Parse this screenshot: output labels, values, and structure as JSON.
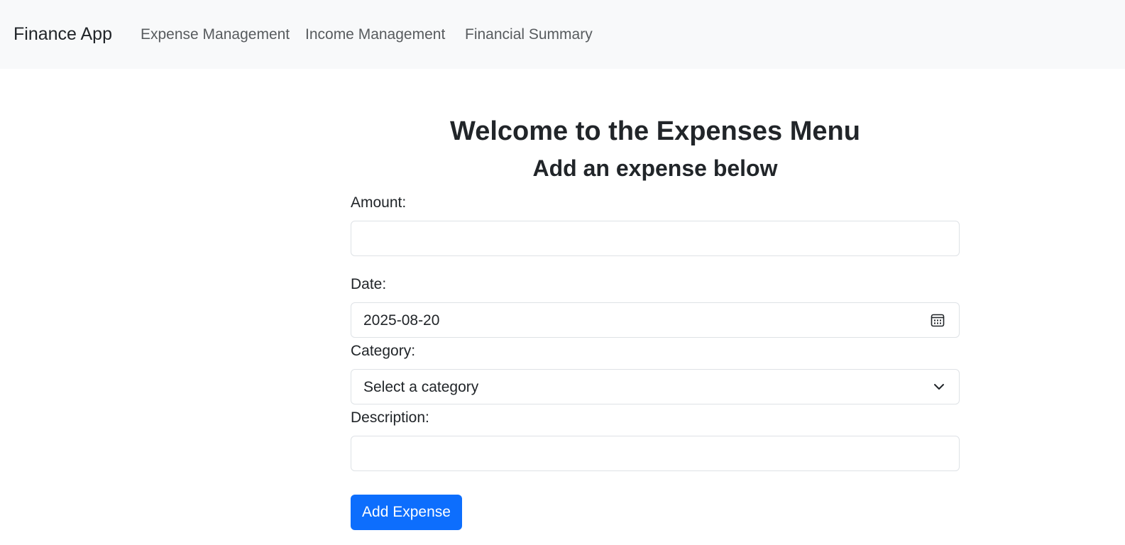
{
  "navbar": {
    "brand": "Finance App",
    "links": [
      {
        "label": "Expense Management"
      },
      {
        "label": "Income Management"
      },
      {
        "label": "Financial Summary"
      }
    ],
    "background": "#f8f9fa"
  },
  "main": {
    "title": "Welcome to the Expenses Menu",
    "subtitle": "Add an expense below"
  },
  "form": {
    "amount": {
      "label": "Amount:",
      "value": ""
    },
    "date": {
      "label": "Date:",
      "value": "2025-08-20",
      "icon": "calendar-icon"
    },
    "category": {
      "label": "Category:",
      "selected": "Select a category",
      "icon": "chevron-down-icon"
    },
    "description": {
      "label": "Description:",
      "value": ""
    },
    "submit_label": "Add Expense"
  },
  "colors": {
    "primary": "#0d6efd",
    "text": "#212529",
    "border": "#dee2e6"
  }
}
